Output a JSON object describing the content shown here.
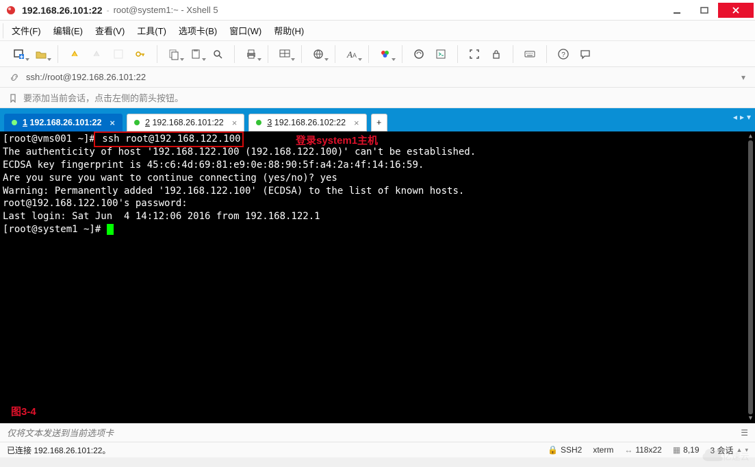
{
  "title": {
    "host": "192.168.26.101:22",
    "subtitle": "root@system1:~ - Xshell 5"
  },
  "menu": {
    "file": "文件(F)",
    "edit": "编辑(E)",
    "view": "查看(V)",
    "tools": "工具(T)",
    "tab": "选项卡(B)",
    "window": "窗口(W)",
    "help": "帮助(H)"
  },
  "addressbar": {
    "url": "ssh://root@192.168.26.101:22"
  },
  "hint": {
    "text": "要添加当前会话，点击左侧的箭头按钮。"
  },
  "tabs": {
    "items": [
      {
        "index": "1",
        "label": "192.168.26.101:22"
      },
      {
        "index": "2",
        "label": "192.168.26.101:22"
      },
      {
        "index": "3",
        "label": "192.168.26.102:22"
      }
    ]
  },
  "terminal": {
    "prompt1_prefix": "[root@vms001 ~]#",
    "prompt1_cmd": " ssh root@192.168.122.100",
    "lines": [
      "The authenticity of host '192.168.122.100 (192.168.122.100)' can't be established.",
      "ECDSA key fingerprint is 45:c6:4d:69:81:e9:0e:88:90:5f:a4:2a:4f:14:16:59.",
      "Are you sure you want to continue connecting (yes/no)? yes",
      "Warning: Permanently added '192.168.122.100' (ECDSA) to the list of known hosts.",
      "root@192.168.122.100's password:",
      "Last login: Sat Jun  4 14:12:06 2016 from 192.168.122.1",
      "[root@system1 ~]# "
    ],
    "annotation_login": "登录system1主机",
    "annotation_fig": "图3-4"
  },
  "sendbar": {
    "placeholder": "仅将文本发送到当前选项卡"
  },
  "statusbar": {
    "connected": "已连接 192.168.26.101:22。",
    "proto": "SSH2",
    "term": "xterm",
    "size": "118x22",
    "cursor": "8,19",
    "sessions": "3 会话"
  },
  "watermark_text": "亿速云"
}
